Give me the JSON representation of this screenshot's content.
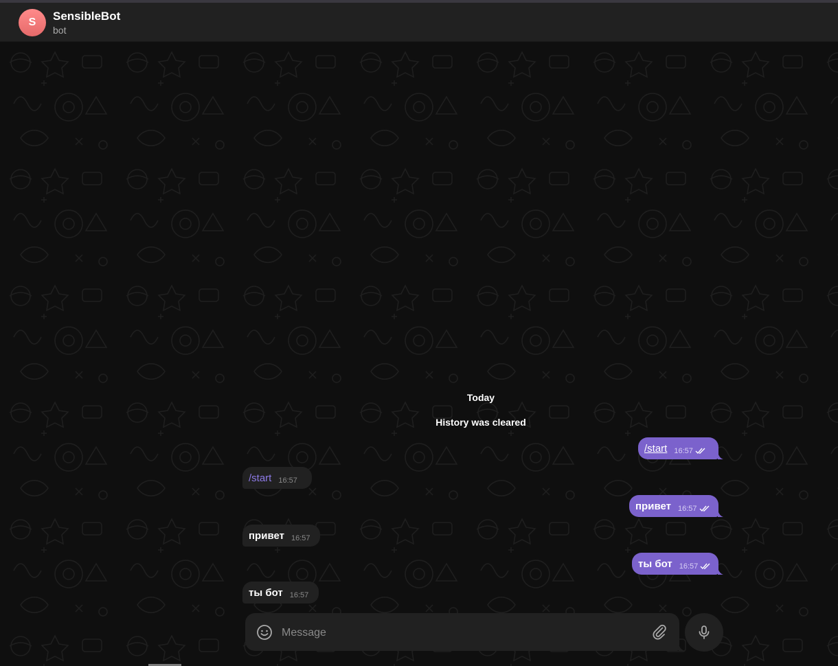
{
  "header": {
    "avatar_letter": "S",
    "title": "SensibleBot",
    "status": "bot"
  },
  "service_messages": {
    "date": "Today",
    "history": "History was cleared"
  },
  "messages": [
    {
      "direction": "out",
      "text": "/start",
      "is_command": true,
      "time": "16:57",
      "read": true
    },
    {
      "direction": "in",
      "text": "/start",
      "is_command": true,
      "time": "16:57"
    },
    {
      "direction": "out",
      "text": "привет",
      "is_command": false,
      "time": "16:57",
      "read": true
    },
    {
      "direction": "in",
      "text": "привет",
      "is_command": false,
      "time": "16:57"
    },
    {
      "direction": "out",
      "text": "ты бот",
      "is_command": false,
      "time": "16:57",
      "read": true
    },
    {
      "direction": "in",
      "text": "ты бот",
      "is_command": false,
      "time": "16:57"
    }
  ],
  "composer": {
    "placeholder": "Message",
    "emoji_icon": "smile-icon",
    "attach_icon": "paperclip-icon",
    "mic_icon": "microphone-icon"
  },
  "colors": {
    "outgoing_bubble": "#7b62cc",
    "incoming_bubble": "#212121",
    "command_link": "#8d7ae6",
    "background": "#0f0f0f"
  }
}
